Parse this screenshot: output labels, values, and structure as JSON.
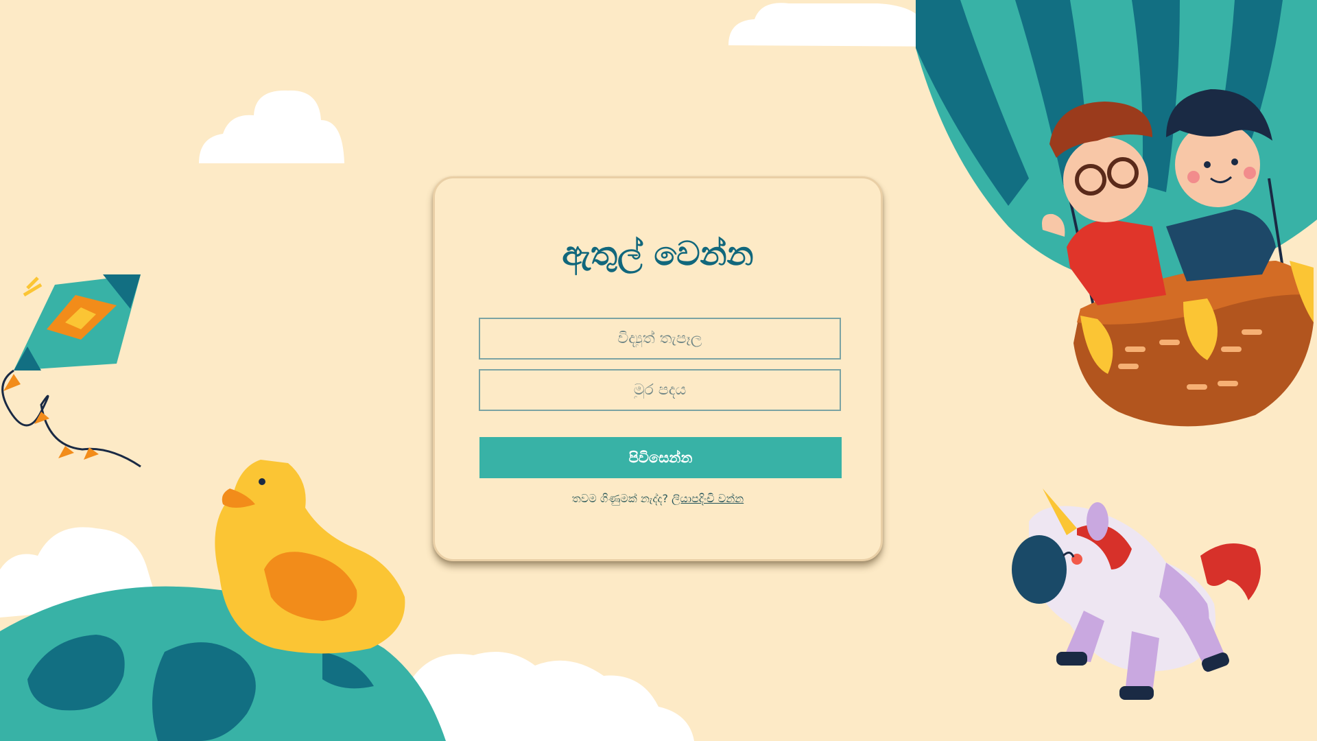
{
  "login": {
    "title": "ඇතුල් වෙන්න",
    "email_placeholder": "විද්‍යුත් තැපෑල",
    "password_placeholder": "මුර පදය",
    "submit_label": "පිවිසෙන්න",
    "signup_prompt": "තවම ගිණුමක් නැද්ද?",
    "signup_link": "ලියාපදිංචි වන්න"
  },
  "colors": {
    "background": "#fdeac6",
    "title": "#11677c",
    "button": "#38b2a6",
    "balloon_teal": "#38b2a6",
    "balloon_dark": "#126f82"
  },
  "illustrations": [
    "kite-icon",
    "duck-icon",
    "hot-air-balloon-icon",
    "kids-icon",
    "unicorn-icon",
    "cloud-icon",
    "globe-icon"
  ]
}
